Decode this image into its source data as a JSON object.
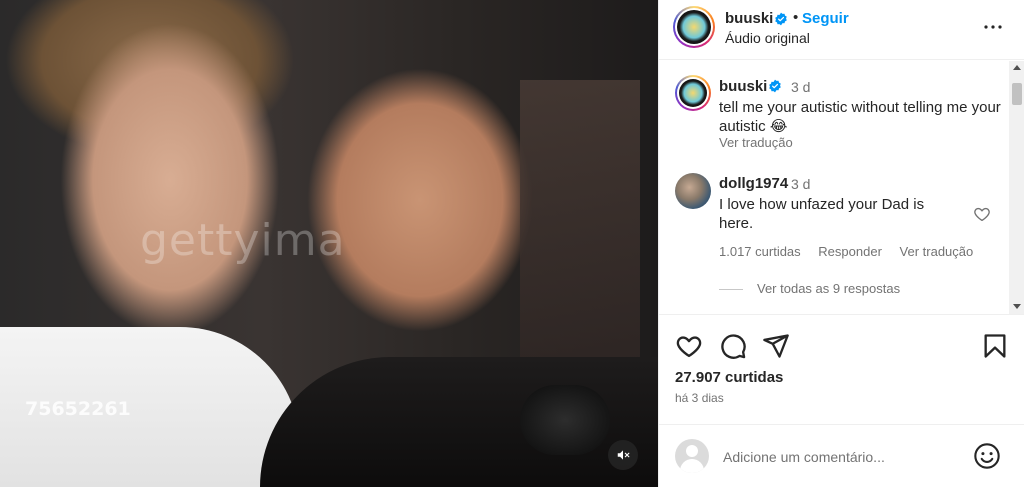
{
  "media": {
    "watermark_text": "gettyima",
    "stock_id": "75652261",
    "mute_icon": "speaker-muted-icon"
  },
  "header": {
    "username": "buuski",
    "verified": true,
    "dot": "•",
    "follow_label": "Seguir",
    "audio_label": "Áudio original",
    "more_icon": "more-horizontal-icon"
  },
  "caption": {
    "username": "buuski",
    "time": "3 d",
    "text": "tell me your autistic without telling me your autistic 😂",
    "translate_label": "Ver tradução"
  },
  "comment": {
    "username": "dollg1974",
    "time": "3 d",
    "text": "I love how unfazed your Dad is here.",
    "likes": "1.017 curtidas",
    "reply_label": "Responder",
    "translate_label": "Ver tradução",
    "view_replies": "Ver todas as 9 respostas"
  },
  "actions": {
    "like_icon": "heart-icon",
    "comment_icon": "comment-icon",
    "share_icon": "share-icon",
    "save_icon": "bookmark-icon"
  },
  "stats": {
    "likes": "27.907 curtidas",
    "date": "há 3 dias"
  },
  "add_comment": {
    "placeholder": "Adicione um comentário...",
    "emoji_icon": "emoji-icon"
  },
  "colors": {
    "accent": "#0095f6",
    "text": "#262626",
    "secondary": "#737373",
    "divider": "#efefef"
  }
}
